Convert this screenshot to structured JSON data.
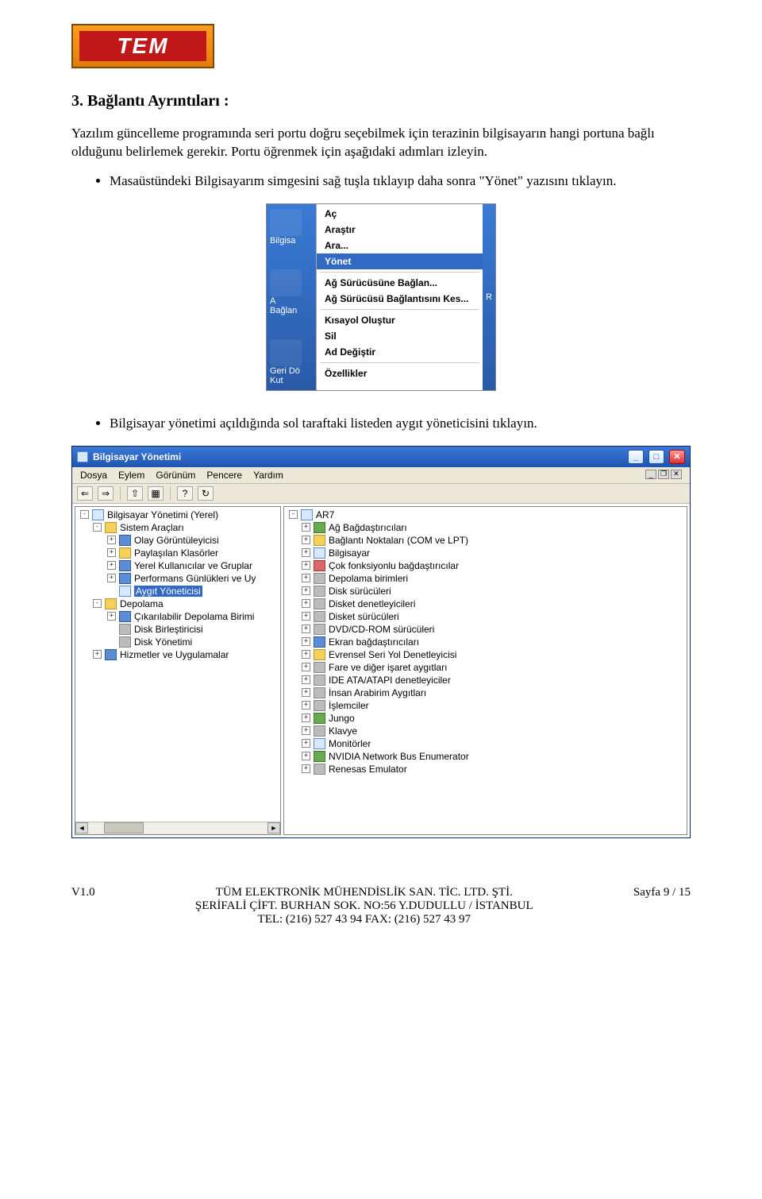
{
  "logo_text": "TEM",
  "section_title": "3. Bağlantı Ayrıntıları :",
  "intro_paragraph": "Yazılım güncelleme programında seri portu doğru seçebilmek için terazinin bilgisayarın hangi portuna bağlı olduğunu belirlemek gerekir. Portu öğrenmek için aşağıdaki adımları izleyin.",
  "bullet1": "Masaüstündeki Bilgisayarım simgesini sağ tuşla tıklayıp daha sonra \"Yönet\" yazısını tıklayın.",
  "bullet2": "Bilgisayar yönetimi açıldığında sol taraftaki listeden aygıt yöneticisini tıklayın.",
  "ctx_left_labels": [
    "Bilgisa",
    "A\nBağlan",
    "Geri Dö\nKut"
  ],
  "ctx_right_letter": "R",
  "ctx_menu": {
    "items": [
      {
        "label": "Aç",
        "sel": false,
        "sep": false
      },
      {
        "label": "Araştır",
        "sel": false,
        "sep": false
      },
      {
        "label": "Ara...",
        "sel": false,
        "sep": false
      },
      {
        "label": "Yönet",
        "sel": true,
        "sep": false
      },
      {
        "sep": true
      },
      {
        "label": "Ağ Sürücüsüne Bağlan...",
        "sel": false,
        "sep": false
      },
      {
        "label": "Ağ Sürücüsü Bağlantısını Kes...",
        "sel": false,
        "sep": false
      },
      {
        "sep": true
      },
      {
        "label": "Kısayol Oluştur",
        "sel": false,
        "sep": false
      },
      {
        "label": "Sil",
        "sel": false,
        "sep": false
      },
      {
        "label": "Ad Değiştir",
        "sel": false,
        "sep": false
      },
      {
        "sep": true
      },
      {
        "label": "Özellikler",
        "sel": false,
        "sep": false
      }
    ]
  },
  "mmc": {
    "title": "Bilgisayar Yönetimi",
    "menubar": [
      "Dosya",
      "Eylem",
      "Görünüm",
      "Pencere",
      "Yardım"
    ],
    "left_tree": [
      {
        "t": "-",
        "ind": 0,
        "icn": "comp",
        "label": "Bilgisayar Yönetimi (Yerel)",
        "sel": false
      },
      {
        "t": "-",
        "ind": 1,
        "icn": "yellow",
        "label": "Sistem Araçları",
        "sel": false
      },
      {
        "t": "+",
        "ind": 2,
        "icn": "blue",
        "label": "Olay Görüntüleyicisi",
        "sel": false
      },
      {
        "t": "+",
        "ind": 2,
        "icn": "yellow",
        "label": "Paylaşılan Klasörler",
        "sel": false
      },
      {
        "t": "+",
        "ind": 2,
        "icn": "blue",
        "label": "Yerel Kullanıcılar ve Gruplar",
        "sel": false
      },
      {
        "t": "+",
        "ind": 2,
        "icn": "blue",
        "label": "Performans Günlükleri ve Uy",
        "sel": false
      },
      {
        "t": " ",
        "ind": 2,
        "icn": "comp",
        "label": "Aygıt Yöneticisi",
        "sel": true
      },
      {
        "t": "-",
        "ind": 1,
        "icn": "yellow",
        "label": "Depolama",
        "sel": false
      },
      {
        "t": "+",
        "ind": 2,
        "icn": "blue",
        "label": "Çıkarılabilir Depolama Birimi",
        "sel": false
      },
      {
        "t": " ",
        "ind": 2,
        "icn": "gray",
        "label": "Disk Birleştiricisi",
        "sel": false
      },
      {
        "t": " ",
        "ind": 2,
        "icn": "gray",
        "label": "Disk Yönetimi",
        "sel": false
      },
      {
        "t": "+",
        "ind": 1,
        "icn": "blue",
        "label": "Hizmetler ve Uygulamalar",
        "sel": false
      }
    ],
    "right_tree": [
      {
        "t": "-",
        "ind": 0,
        "icn": "comp",
        "label": "AR7"
      },
      {
        "t": "+",
        "ind": 1,
        "icn": "green",
        "label": "Ağ Bağdaştırıcıları"
      },
      {
        "t": "+",
        "ind": 1,
        "icn": "yellow",
        "label": "Bağlantı Noktaları (COM ve LPT)"
      },
      {
        "t": "+",
        "ind": 1,
        "icn": "comp",
        "label": "Bilgisayar"
      },
      {
        "t": "+",
        "ind": 1,
        "icn": "red",
        "label": "Çok fonksiyonlu bağdaştırıcılar"
      },
      {
        "t": "+",
        "ind": 1,
        "icn": "gray",
        "label": "Depolama birimleri"
      },
      {
        "t": "+",
        "ind": 1,
        "icn": "gray",
        "label": "Disk sürücüleri"
      },
      {
        "t": "+",
        "ind": 1,
        "icn": "gray",
        "label": "Disket denetleyicileri"
      },
      {
        "t": "+",
        "ind": 1,
        "icn": "gray",
        "label": "Disket sürücüleri"
      },
      {
        "t": "+",
        "ind": 1,
        "icn": "gray",
        "label": "DVD/CD-ROM sürücüleri"
      },
      {
        "t": "+",
        "ind": 1,
        "icn": "blue",
        "label": "Ekran bağdaştırıcıları"
      },
      {
        "t": "+",
        "ind": 1,
        "icn": "yellow",
        "label": "Evrensel Seri Yol Denetleyicisi"
      },
      {
        "t": "+",
        "ind": 1,
        "icn": "gray",
        "label": "Fare ve diğer işaret aygıtları"
      },
      {
        "t": "+",
        "ind": 1,
        "icn": "gray",
        "label": "IDE ATA/ATAPI denetleyiciler"
      },
      {
        "t": "+",
        "ind": 1,
        "icn": "gray",
        "label": "İnsan Arabirim Aygıtları"
      },
      {
        "t": "+",
        "ind": 1,
        "icn": "gray",
        "label": "İşlemciler"
      },
      {
        "t": "+",
        "ind": 1,
        "icn": "green",
        "label": "Jungo"
      },
      {
        "t": "+",
        "ind": 1,
        "icn": "gray",
        "label": "Klavye"
      },
      {
        "t": "+",
        "ind": 1,
        "icn": "comp",
        "label": "Monitörler"
      },
      {
        "t": "+",
        "ind": 1,
        "icn": "green",
        "label": "NVIDIA Network Bus Enumerator"
      },
      {
        "t": "+",
        "ind": 1,
        "icn": "gray",
        "label": "Renesas Emulator"
      }
    ]
  },
  "footer": {
    "left": "V1.0",
    "line1": "TÜM ELEKTRONİK MÜHENDİSLİK SAN. TİC. LTD. ŞTİ.",
    "line2": "ŞERİFALİ ÇİFT. BURHAN SOK. NO:56 Y.DUDULLU / İSTANBUL",
    "line3": "TEL: (216) 527 43 94 FAX: (216) 527 43 97",
    "right": "Sayfa 9 / 15"
  }
}
